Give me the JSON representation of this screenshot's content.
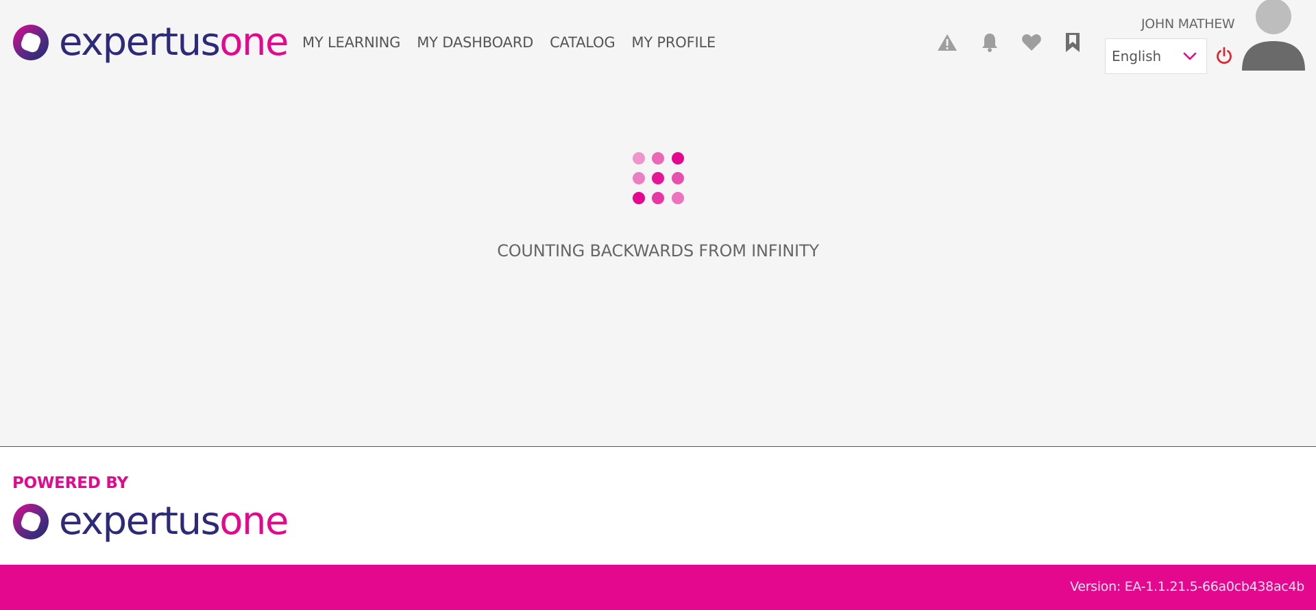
{
  "header": {
    "logo": {
      "part1": "expertus",
      "part2": "one"
    },
    "nav": [
      {
        "label": "MY LEARNING"
      },
      {
        "label": "MY DASHBOARD"
      },
      {
        "label": "CATALOG"
      },
      {
        "label": "MY PROFILE"
      }
    ],
    "icons": [
      "alert-icon",
      "bell-icon",
      "heart-icon",
      "bookmark-icon"
    ],
    "user_name": "JOHN MATHEW",
    "language": {
      "selected": "English"
    }
  },
  "loader": {
    "message": "COUNTING BACKWARDS FROM INFINITY"
  },
  "footer": {
    "powered_by": "POWERED BY",
    "logo": {
      "part1": "expertus",
      "part2": "one"
    },
    "version": "Version: EA-1.1.21.5-66a0cb438ac4b"
  },
  "colors": {
    "brand_magenta": "#e4088f",
    "brand_navy": "#2e2a7a",
    "icon_gray": "#9e9e9e",
    "power_red": "#e0252f"
  }
}
